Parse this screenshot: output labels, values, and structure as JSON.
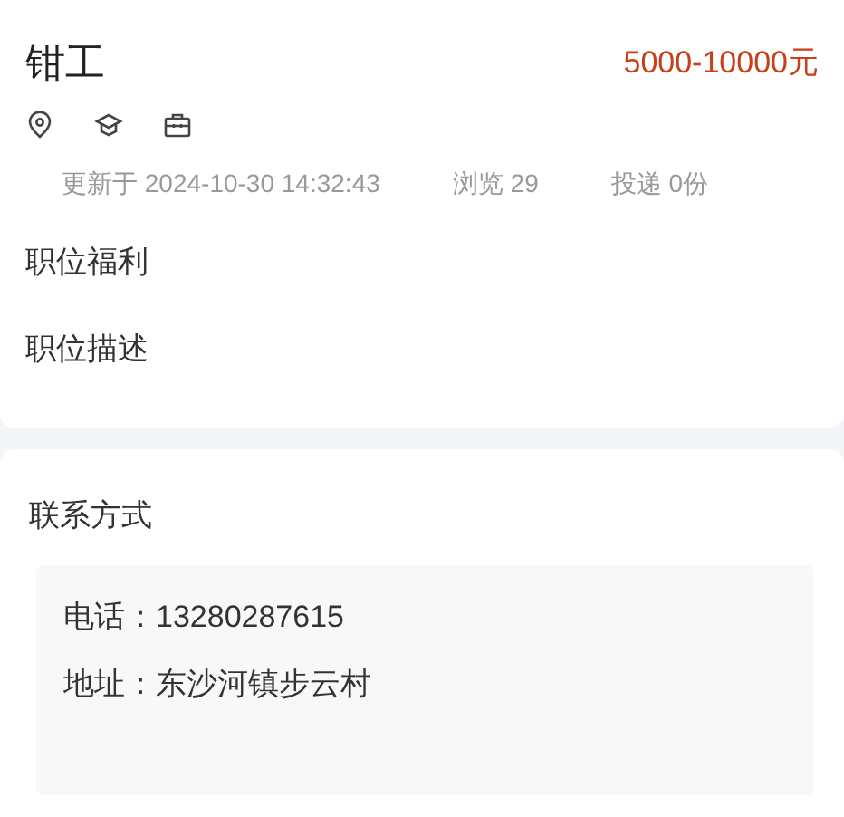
{
  "job": {
    "title": "钳工",
    "salary": "5000-10000元"
  },
  "meta": [
    "更新于 2024-10-30 14:32:43",
    "浏览 29",
    "投递 0份"
  ],
  "sections": [
    "职位福利",
    "职位描述"
  ],
  "contact": {
    "heading": "联系方式",
    "lines": [
      "电话：13280287615",
      "地址：东沙河镇步云村"
    ]
  }
}
